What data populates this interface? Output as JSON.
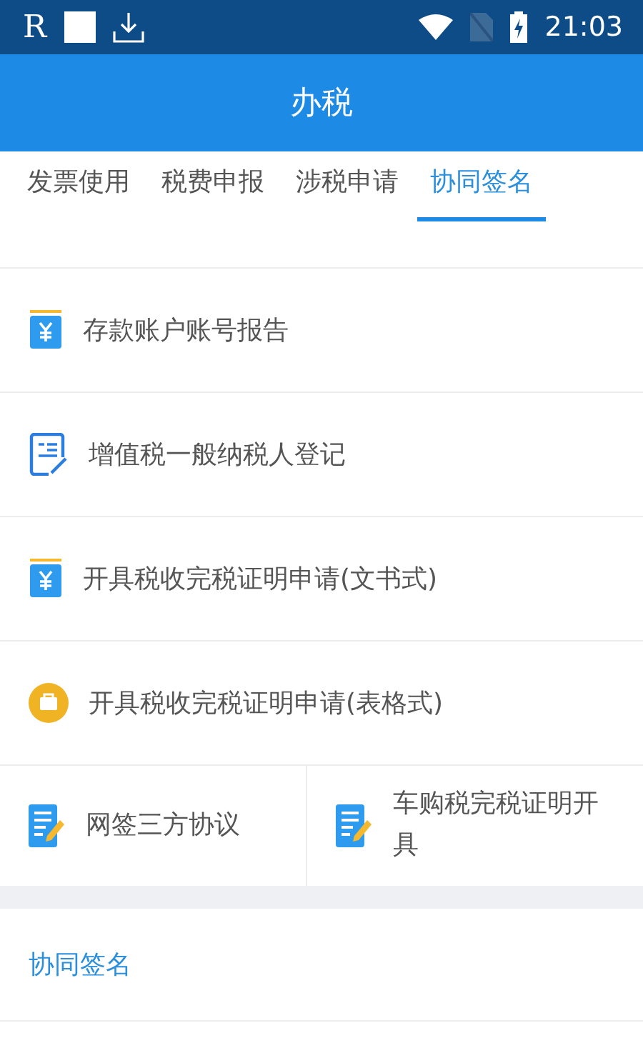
{
  "status_bar": {
    "glyph": "R",
    "time": "21:03"
  },
  "header": {
    "title": "办税"
  },
  "tabs": [
    {
      "label": "发票使用",
      "selected": false
    },
    {
      "label": "税费申报",
      "selected": false
    },
    {
      "label": "涉税申请",
      "selected": false
    },
    {
      "label": "协同签名",
      "selected": true
    }
  ],
  "items": [
    {
      "label": "存款账户账号报告",
      "kind": "yen"
    },
    {
      "label": "增值税一般纳税人登记",
      "kind": "form"
    },
    {
      "label": "开具税收完税证明申请(文书式)",
      "kind": "yen"
    },
    {
      "label": "开具税收完税证明申请(表格式)",
      "kind": "coin"
    }
  ],
  "grid_items": [
    {
      "label": "网签三方协议",
      "kind": "pencil"
    },
    {
      "label": "车购税完税证明开具",
      "kind": "pencil"
    }
  ],
  "section": {
    "title": "协同签名"
  }
}
